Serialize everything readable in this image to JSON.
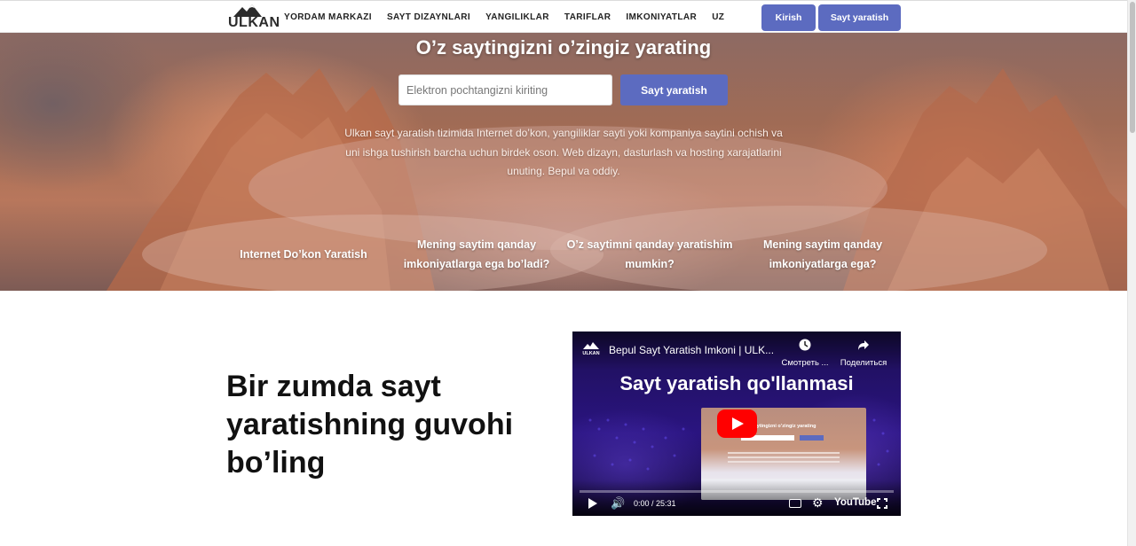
{
  "nav": {
    "logo_text": "ULKAN",
    "menu": [
      "YORDAM MARKAZI",
      "SAYT DIZAYNLARI",
      "YANGILIKLAR",
      "TARIFLAR",
      "IMKONIYATLAR",
      "UZ"
    ],
    "login_label": "Kirish",
    "create_label": "Sayt yaratish"
  },
  "hero": {
    "title": "O’z saytingizni o’zingiz yarating",
    "email_placeholder": "Elektron pochtangizni kiriting",
    "button_label": "Sayt yaratish",
    "description": "Ulkan sayt yaratish tizimida Internet do’kon, yangiliklar sayti yoki kompaniya saytini ochish va uni ishga tushirish barcha uchun birdek oson. Web dizayn, dasturlash va hosting xarajatlarini unuting. Bepul va oddiy.",
    "links": [
      "Internet Do’kon Yaratish",
      "Mening saytim qanday imkoniyatlarga ega bo’ladi?",
      "O’z saytimni qanday yaratishim mumkin?",
      "Mening saytim qanday imkoniyatlarga ega?"
    ]
  },
  "section": {
    "title": "Bir zumda sayt yaratishning guvohi bo’ling"
  },
  "video": {
    "channel_logo": "ULKAN",
    "title": "Bepul Sayt Yaratish Imkoni | ULK...",
    "watch_later_label": "Смотреть ...",
    "share_label": "Поделиться",
    "heading": "Sayt yaratish qo'llanmasi",
    "thumb_title": "saytingizni o’zingiz yarating",
    "time": "0:00 / 25:31",
    "progress": 0,
    "brand": "YouTube",
    "icons": [
      "clock-icon",
      "share-icon",
      "play-icon",
      "volume-icon",
      "captions-icon",
      "gear-icon",
      "fullscreen-icon"
    ]
  },
  "colors": {
    "accent": "#5c6bc0",
    "youtube_red": "#ff0000",
    "video_bg": "#2a1480"
  }
}
